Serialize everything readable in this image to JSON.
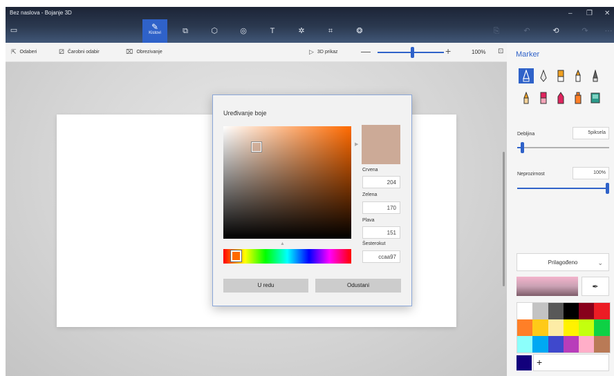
{
  "window": {
    "title": "Bez naslova - Bojanje 3D",
    "menu_icon": "menu-icon",
    "active_tab_label": "Kistovi",
    "tabs": [
      "brushes-icon",
      "2d-shapes-icon",
      "3d-shapes-icon",
      "stickers-icon",
      "text-icon",
      "effects-icon",
      "canvas-icon",
      "3d-library-icon"
    ]
  },
  "toolbar": {
    "select_label": "Odaberi",
    "magic_select_label": "Čarobni odabir",
    "crop_label": "Obrezivanje",
    "view3d_label": "3D prikaz",
    "zoom_minus": "—",
    "zoom_plus": "+",
    "zoom_value": "100%",
    "zoom_percent": 53
  },
  "dialog": {
    "title": "Uređivanje boje",
    "red_label": "Crvena",
    "red_value": "204",
    "green_label": "Zelena",
    "green_value": "170",
    "blue_label": "Plava",
    "blue_value": "151",
    "hex_label": "Šesterokut",
    "hex_value": "ccaa97",
    "preview_color": "#ccaa97",
    "ok_label": "U redu",
    "cancel_label": "Odustani"
  },
  "panel": {
    "title": "Marker",
    "thickness_label": "Debljina",
    "thickness_value": "5piksela",
    "opacity_label": "Neprozirnost",
    "opacity_value": "100%",
    "color_mode": "Prilagođeno",
    "add_label": "+",
    "custom_color": "#12007c",
    "palette": [
      "#ffffff",
      "#c3c3c3",
      "#585858",
      "#000000",
      "#88001b",
      "#ec1c24",
      "#ff7f27",
      "#ffca18",
      "#fdeca6",
      "#fff200",
      "#c4ff0e",
      "#0ed145",
      "#8cfffb",
      "#00a8f3",
      "#3f48cc",
      "#b83dba",
      "#ffaec8",
      "#b97a56"
    ]
  }
}
